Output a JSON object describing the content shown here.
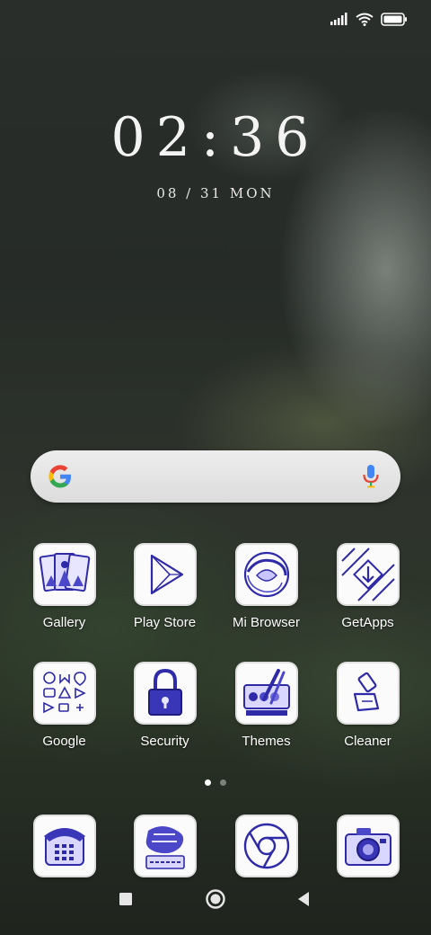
{
  "status_bar": {
    "signal_icon": "signal-icon",
    "wifi_icon": "wifi-icon",
    "battery_icon": "battery-icon"
  },
  "lock_widget": {
    "time": "02:36",
    "date": "08 / 31  MON"
  },
  "search_bar": {
    "logo": "google-g-icon",
    "mic": "microphone-icon"
  },
  "apps_row1": [
    {
      "label": "Gallery",
      "icon": "gallery-icon"
    },
    {
      "label": "Play Store",
      "icon": "play-store-icon"
    },
    {
      "label": "Mi Browser",
      "icon": "mi-browser-icon"
    },
    {
      "label": "GetApps",
      "icon": "getapps-icon"
    }
  ],
  "apps_row2": [
    {
      "label": "Google",
      "icon": "google-folder-icon"
    },
    {
      "label": "Security",
      "icon": "security-icon"
    },
    {
      "label": "Themes",
      "icon": "themes-icon"
    },
    {
      "label": "Cleaner",
      "icon": "cleaner-icon"
    }
  ],
  "dock": [
    {
      "icon": "phone-icon"
    },
    {
      "icon": "messaging-icon"
    },
    {
      "icon": "chrome-icon"
    },
    {
      "icon": "camera-icon"
    }
  ],
  "page_indicator": {
    "pages": 2,
    "current": 1
  },
  "colors": {
    "ink": "#2e2aa8",
    "icon_bg": "#fbfbfb"
  }
}
